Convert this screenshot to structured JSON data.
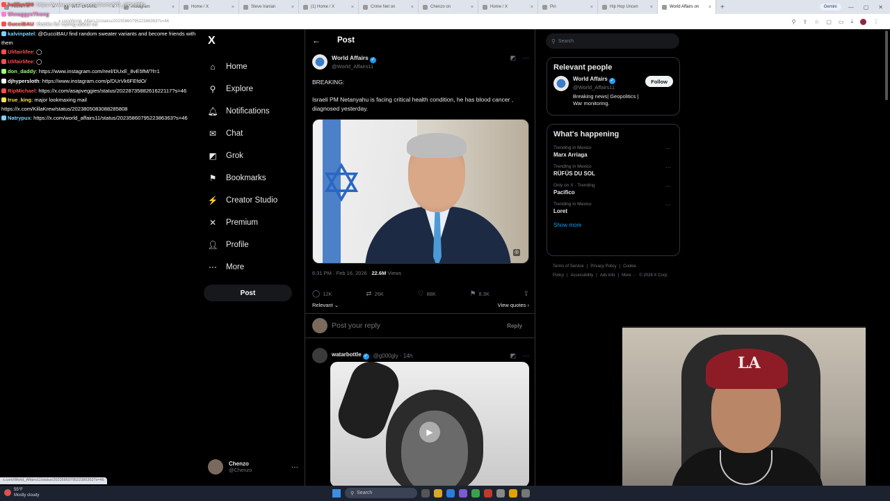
{
  "browser": {
    "tabs": [
      {
        "label": "Home / X",
        "active": false
      },
      {
        "label": "WTF DHARIL",
        "active": false
      },
      {
        "label": "Instagram",
        "active": false
      },
      {
        "label": "Home / X",
        "active": false
      },
      {
        "label": "Steve Iranian",
        "active": false
      },
      {
        "label": "(1) Home / X",
        "active": false
      },
      {
        "label": "Crime Net on",
        "active": false
      },
      {
        "label": "Chenzo on",
        "active": false
      },
      {
        "label": "Home / X",
        "active": false
      },
      {
        "label": "Pin",
        "active": false
      },
      {
        "label": "Hip Hop Uncen",
        "active": false
      },
      {
        "label": "World Affairs on",
        "active": true
      }
    ],
    "gemini_label": "Gemini",
    "url": "x.com/World_Affairs11/status/2023586079522386363?s=46"
  },
  "chat": [
    {
      "user": "hellfire350",
      "color": "#ff4d4d",
      "text": ": https://www.youtube.com/shorts/ND_plQn8Efo"
    },
    {
      "user": "ShnaggysThong",
      "color": "#ff7bd5",
      "text": ""
    },
    {
      "user": "GucciBAU",
      "color": "#ff4d4d",
      "text": ": thanks for caring about us"
    },
    {
      "user": "kalvinpatel",
      "color": "#7bd3ff",
      "text": ": @GucciBAU find random sweater variants and become friends with them"
    },
    {
      "user": "Ulifairlifee",
      "color": "#ff4d4d",
      "text": ": ◯"
    },
    {
      "user": "Ulifairlifee",
      "color": "#ff4d4d",
      "text": ": ◯"
    },
    {
      "user": "don_daddy",
      "color": "#9cff7b",
      "text": ": https://www.instagram.com/reel/DUxE_8vE5fM/?l=1"
    },
    {
      "user": "djhypersloth",
      "color": "#ffffff",
      "text": ": https://www.instagram.com/p/DUrVk6FEfdO/"
    },
    {
      "user": "RipMichael",
      "color": "#ff4d4d",
      "text": ": https://x.com/asapveggies/status/2022873588261622117?s=46"
    },
    {
      "user": "true_king",
      "color": "#ffe14d",
      "text": ": major lookmaxing mail https://x.com/KillaKrew/status/2023805083088285808"
    },
    {
      "user": "Natrypux",
      "color": "#7bd3ff",
      "text": ": https://x.com/world_affairs11/status/2023586079522386363?s=46"
    }
  ],
  "nav": {
    "logo": "X",
    "items": [
      {
        "label": "Home",
        "icon": "⌂"
      },
      {
        "label": "Explore",
        "icon": "⚲"
      },
      {
        "label": "Notifications",
        "icon": "🔔︎"
      },
      {
        "label": "Chat",
        "icon": "✉"
      },
      {
        "label": "Grok",
        "icon": "◩"
      },
      {
        "label": "Bookmarks",
        "icon": "⚑"
      },
      {
        "label": "Creator Studio",
        "icon": "⚡"
      },
      {
        "label": "Premium",
        "icon": "✕"
      },
      {
        "label": "Profile",
        "icon": "👤︎"
      },
      {
        "label": "More",
        "icon": "⋯"
      }
    ],
    "post_label": "Post",
    "account": {
      "name": "Chenzo",
      "handle": "@Chenzo"
    }
  },
  "main": {
    "title": "Post",
    "tweet": {
      "name": "World Affairs",
      "handle": "@World_Affairs11",
      "text_line1": "BREAKING:",
      "text_line2": "Israeli PM Netanyahu is facing critical health condition, he has blood cancer , diagnosed yesterday.",
      "time": "6:31 PM · Feb 16, 2026 · ",
      "views": "22.6M",
      "views_label": " Views",
      "replies": "12K",
      "reposts": "26K",
      "likes": "88K",
      "bookmarks": "8.3K",
      "relevant_label": "Relevant",
      "view_quotes_label": "View quotes"
    },
    "reply_placeholder": "Post your reply",
    "reply_button": "Reply",
    "reply_tweet": {
      "name": "watarbottle",
      "handle": "@g000gly · 14h"
    }
  },
  "sidebar": {
    "search_placeholder": "Search",
    "relevant_title": "Relevant people",
    "person": {
      "name": "World Affairs",
      "handle": "@World_Affairs11",
      "bio": "Breaking news| Geopolitics | War monitoring.",
      "follow_label": "Follow"
    },
    "happening_title": "What's happening",
    "trends": [
      {
        "context": "Trending in Mexico",
        "name": "Marx Arriaga"
      },
      {
        "context": "Trending in Mexico",
        "name": "RÜFÜS DU SOL"
      },
      {
        "context": "Only on X · Trending",
        "name": "Pacifico"
      },
      {
        "context": "Trending in Mexico",
        "name": "Loret"
      }
    ],
    "show_more": "Show more",
    "footer": [
      "Terms of Service",
      "|",
      "Privacy Policy",
      "|",
      "Cookie Policy",
      "|",
      "Accessibility",
      "|",
      "Ads info",
      "|",
      "More ···",
      "© 2026 X Corp."
    ]
  },
  "taskbar": {
    "weather_temp": "55°F",
    "weather_text": "Mostly cloudy",
    "search_label": "Search"
  }
}
